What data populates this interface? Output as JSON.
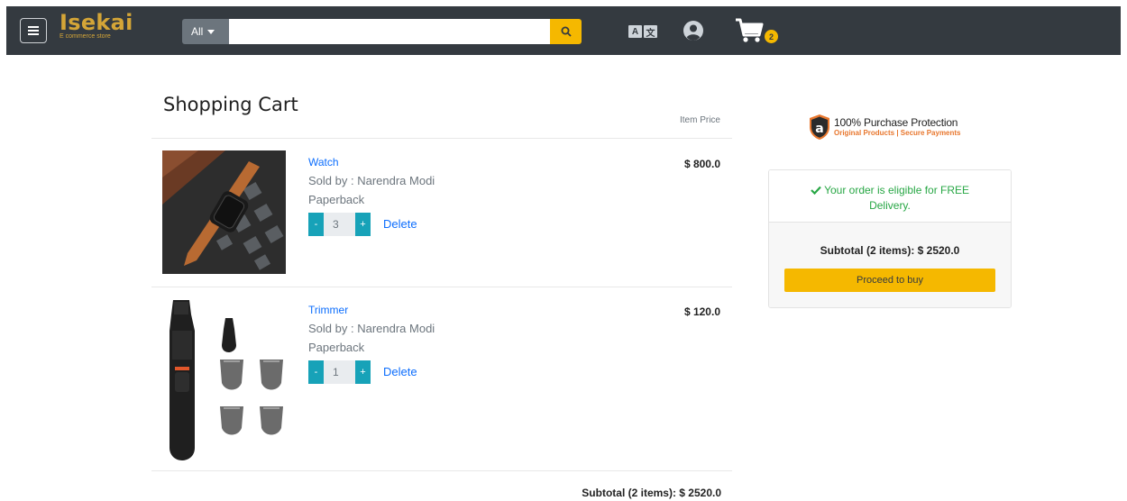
{
  "brand": {
    "name": "Isekai",
    "tagline": "E commerce store",
    "accent": "#d4a537"
  },
  "search": {
    "category": "All",
    "placeholder": "",
    "value": ""
  },
  "header": {
    "cart_count": "2",
    "lang_left": "A",
    "lang_right": "文"
  },
  "cart": {
    "title": "Shopping Cart",
    "price_header": "Item Price",
    "items": [
      {
        "name": "Watch",
        "seller": "Sold by : Narendra Modi",
        "format": "Paperback",
        "qty": "3",
        "price": "$ 800.0",
        "image": "watch"
      },
      {
        "name": "Trimmer",
        "seller": "Sold by : Narendra Modi",
        "format": "Paperback",
        "qty": "1",
        "price": "$ 120.0",
        "image": "trimmer"
      }
    ],
    "minus_label": "-",
    "plus_label": "+",
    "delete_label": "Delete",
    "subtotal": "Subtotal (2 items): $ 2520.0"
  },
  "sidebar": {
    "protection_main": "100% Purchase Protection",
    "protection_sub": "Original Products | Secure Payments",
    "protection_logo": "a",
    "free_delivery": "Your order is eligible for FREE Delivery.",
    "subtotal": "Subtotal (2 items): $ 2520.0",
    "buy_label": "Proceed to buy"
  },
  "colors": {
    "navbar": "#343a40",
    "accent": "#f5b800",
    "link": "#0d6efd",
    "qty_button": "#17a2b8",
    "success": "#28a745"
  }
}
